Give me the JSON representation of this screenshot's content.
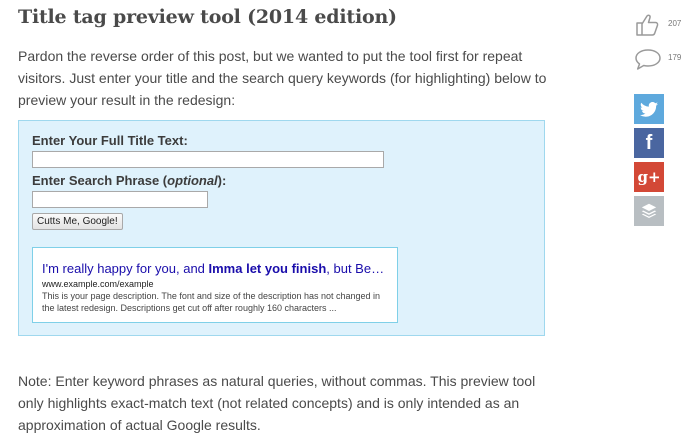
{
  "article": {
    "title": "Title tag preview tool (2014 edition)",
    "intro": "Pardon the reverse order of this post, but we wanted to put the tool first for repeat visitors. Just enter your title and the search query keywords (for highlighting) below to preview your result in the redesign:",
    "note": "Note: Enter keyword phrases as natural queries, without commas. This preview tool only highlights exact-match text (not related concepts) and is only intended as an approximation of actual Google results."
  },
  "tool": {
    "title_label": "Enter Your Full Title Text:",
    "title_value": "",
    "phrase_label_main": "Enter Search Phrase (",
    "phrase_label_opt": "optional",
    "phrase_label_end": "):",
    "phrase_value": "",
    "button_label": "Cutts Me, Google!"
  },
  "preview": {
    "title_before": "I'm really happy for you, and ",
    "title_bold": "Imma let you finish",
    "title_after": ", but Beyonc...",
    "url": "www.example.com/example",
    "description": "This is your page description. The font and size of the description has not changed in the latest redesign. Descriptions get cut off after roughly 160 characters ..."
  },
  "sidebar": {
    "likes_count": "207",
    "comments_count": "179",
    "icons": {
      "likes": "thumbs-up-icon",
      "comments": "comment-icon",
      "twitter": "twitter-icon",
      "facebook": "facebook-icon",
      "googleplus": "google-plus-icon",
      "buffer": "buffer-icon"
    },
    "facebook_glyph": "f",
    "googleplus_glyph": "g+"
  },
  "colors": {
    "tool_bg": "#dff2fc",
    "tool_border": "#9fd8ee",
    "preview_link": "#1a0dab",
    "twitter": "#5ea9dd",
    "facebook": "#4a66a0",
    "googleplus": "#d34836",
    "buffer": "#b8bec2"
  }
}
